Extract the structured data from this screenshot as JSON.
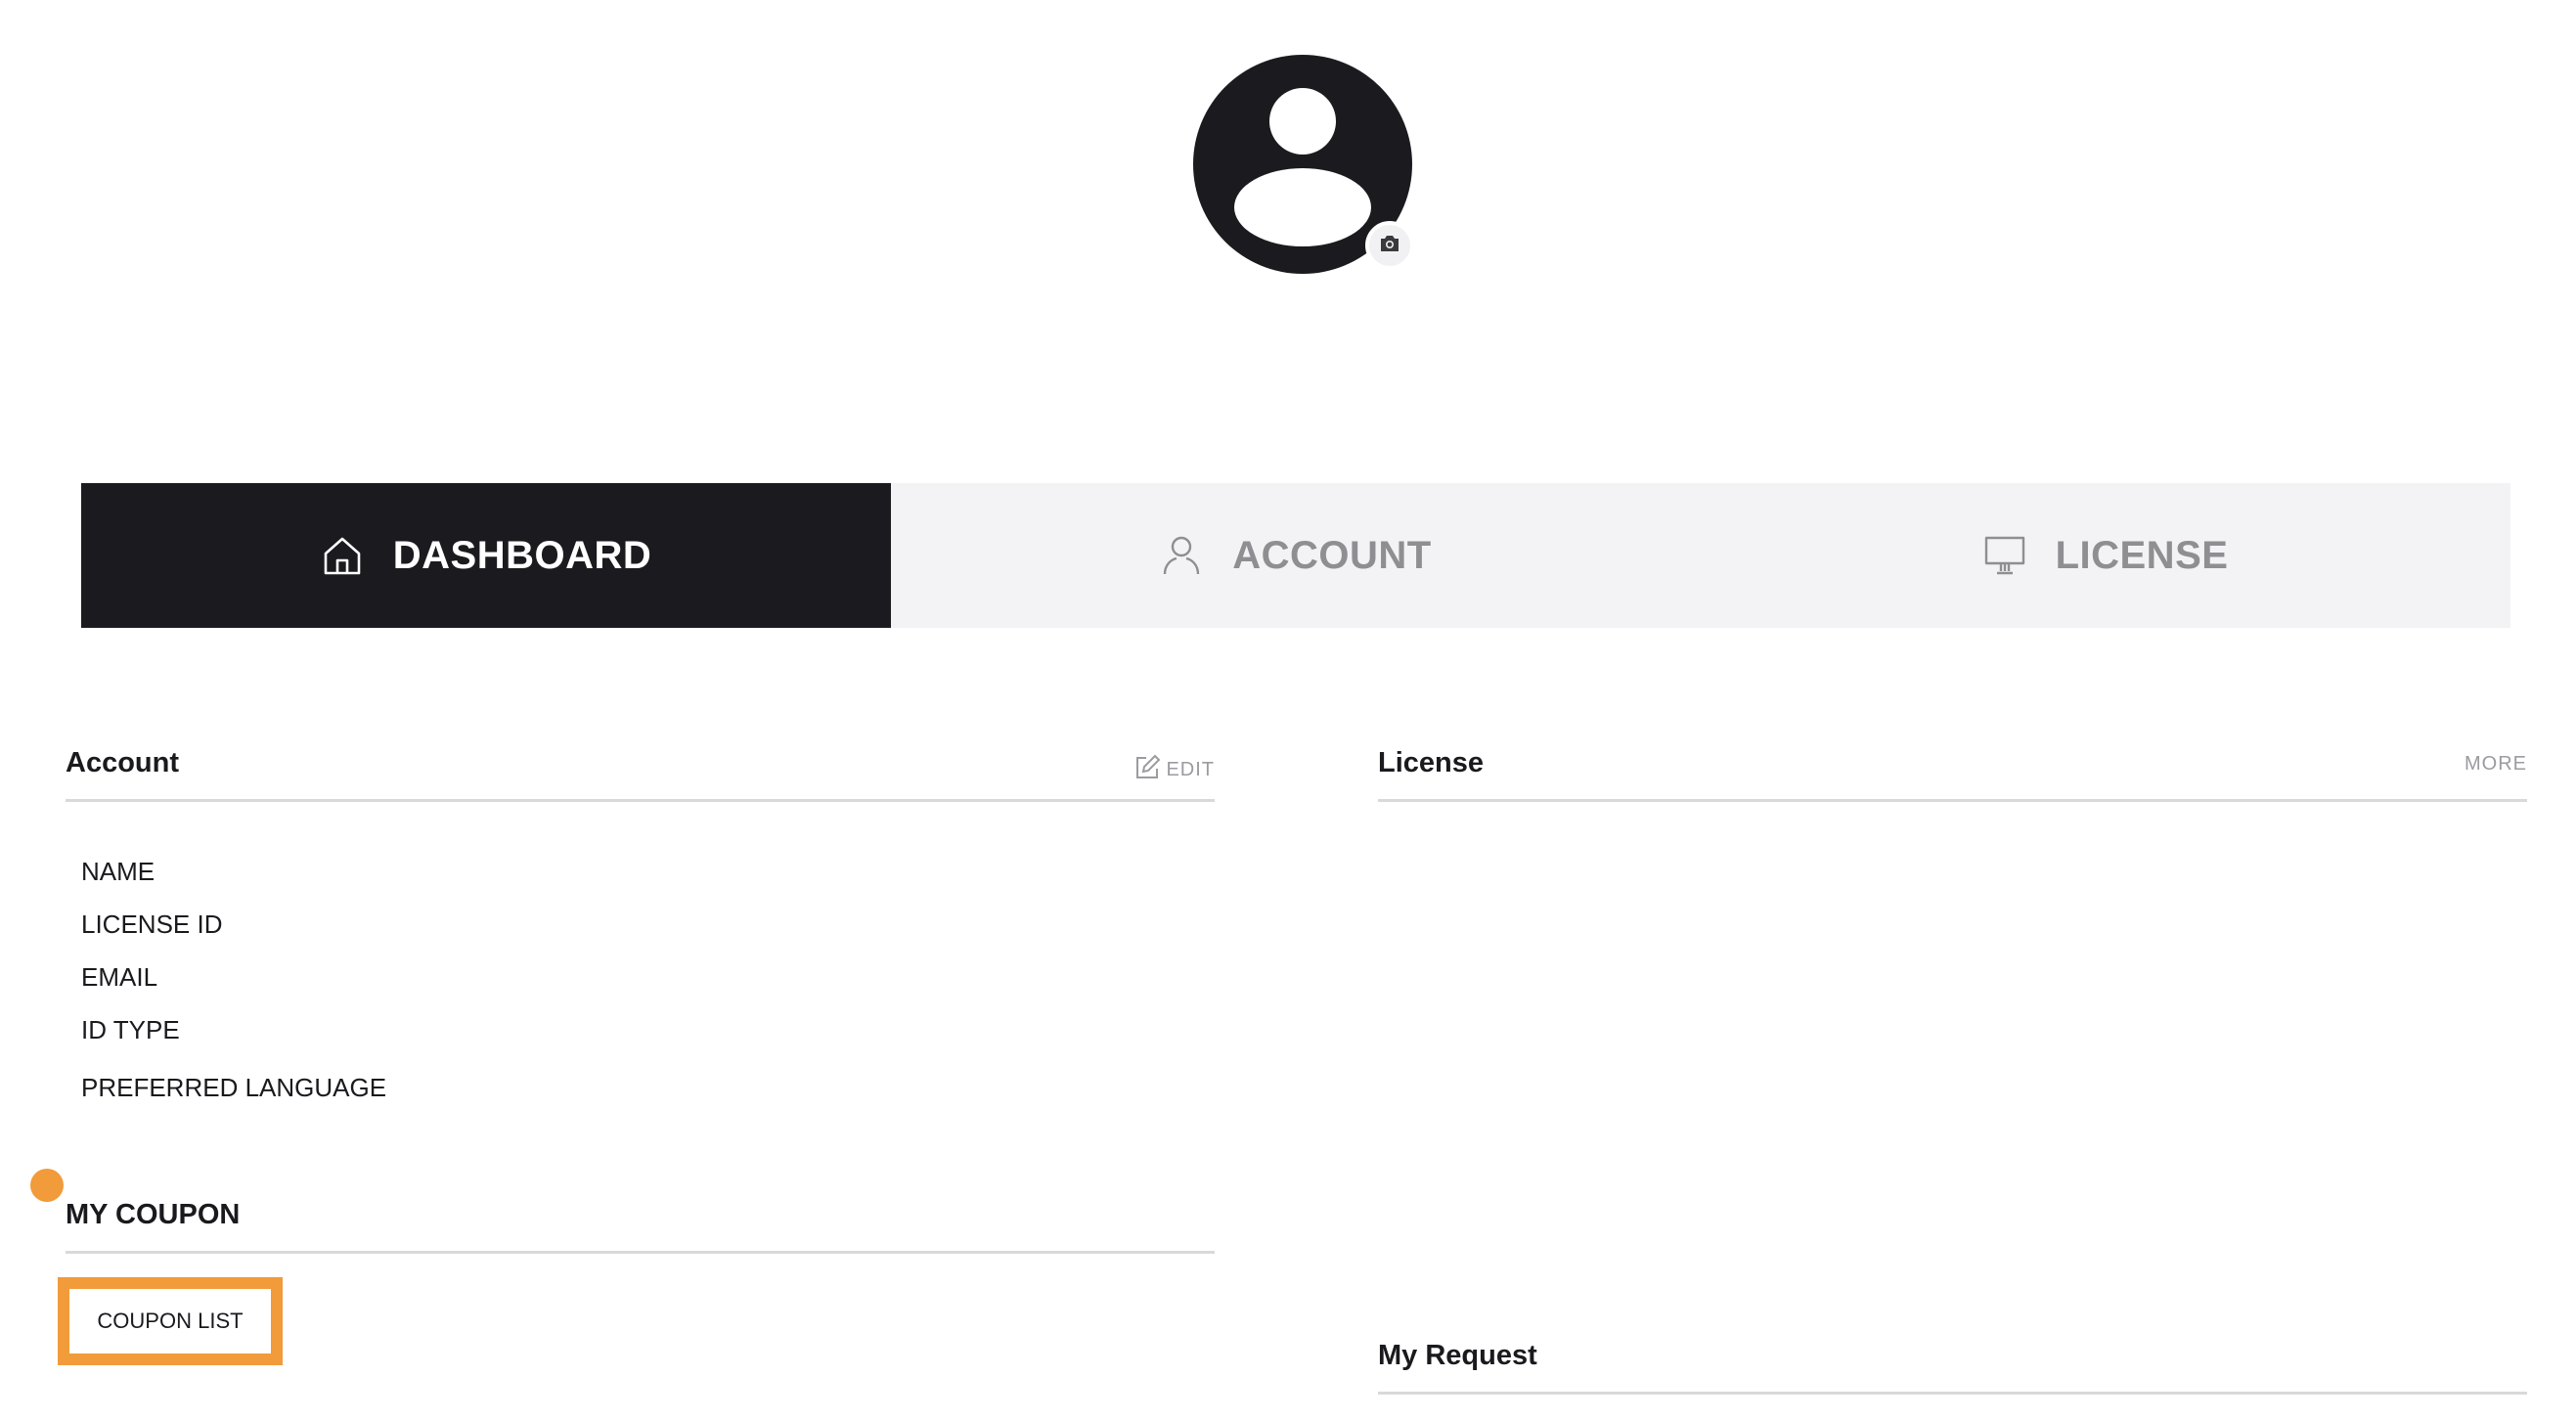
{
  "tabs": [
    {
      "label": "DASHBOARD",
      "icon": "home-icon",
      "active": true
    },
    {
      "label": "ACCOUNT",
      "icon": "user-icon",
      "active": false
    },
    {
      "label": "LICENSE",
      "icon": "monitor-icon",
      "active": false
    }
  ],
  "account": {
    "title": "Account",
    "edit_label": "EDIT",
    "fields": [
      "NAME",
      "LICENSE ID",
      "EMAIL",
      "ID TYPE",
      "PREFERRED LANGUAGE"
    ]
  },
  "license": {
    "title": "License",
    "more_label": "MORE"
  },
  "coupon": {
    "title": "MY COUPON",
    "button_label": "COUPON LIST"
  },
  "request": {
    "title": "My Request"
  },
  "colors": {
    "accent": "#f19b3a",
    "dark": "#1b1b1f",
    "tab_bg": "#f3f3f5",
    "muted": "#8e8e93"
  }
}
